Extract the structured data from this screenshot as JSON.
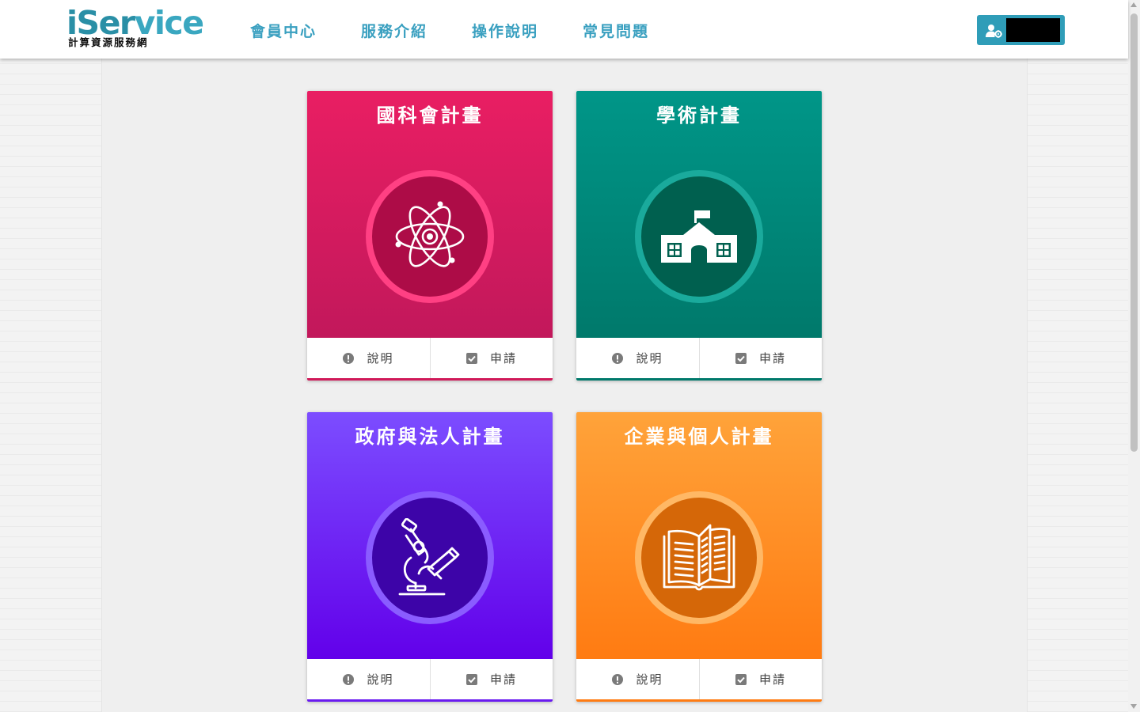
{
  "header": {
    "logo": {
      "brand": "iService",
      "subtitle": "計算資源服務網"
    },
    "nav": [
      {
        "label": "會員中心"
      },
      {
        "label": "服務介紹"
      },
      {
        "label": "操作說明"
      },
      {
        "label": "常見問題"
      }
    ],
    "user_button": {
      "icon": "user-gear-icon"
    }
  },
  "cards": [
    {
      "title": "國科會計畫",
      "icon": "atom-icon",
      "color": "#e91e63",
      "info_label": "說明",
      "apply_label": "申請"
    },
    {
      "title": "學術計畫",
      "icon": "school-icon",
      "color": "#009688",
      "info_label": "說明",
      "apply_label": "申請"
    },
    {
      "title": "政府與法人計畫",
      "icon": "microscope-icon",
      "color": "#7c4dff",
      "info_label": "說明",
      "apply_label": "申請"
    },
    {
      "title": "企業與個人計畫",
      "icon": "open-book-icon",
      "color": "#ff8f1f",
      "info_label": "說明",
      "apply_label": "申請"
    }
  ]
}
